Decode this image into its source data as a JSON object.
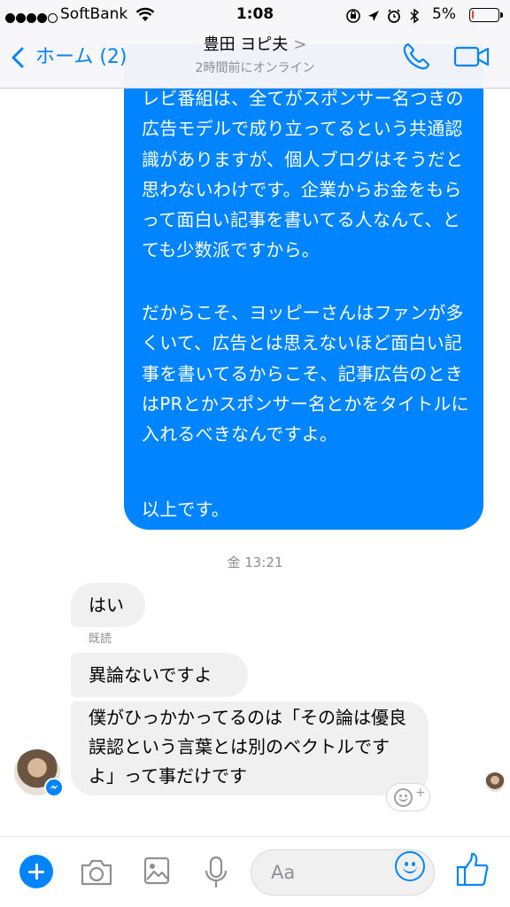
{
  "status_bar": {
    "carrier": "SoftBank",
    "time": "1:08",
    "battery_percent": "5%",
    "battery_level": 0.05,
    "icons": [
      "signal-dots-icon",
      "wifi-icon",
      "orientation-lock-icon",
      "location-icon",
      "alarm-icon",
      "bluetooth-icon",
      "battery-icon"
    ]
  },
  "header": {
    "back_label": "ホーム (2)",
    "contact_name": "豊田 ヨピ夫",
    "name_chevron": ">",
    "presence": "2時間前にオンライン",
    "icons": [
      "chevron-left-icon",
      "phone-icon",
      "video-camera-icon"
    ]
  },
  "messages": {
    "outgoing_paragraphs": [
      "レビ番組は、全てがスポンサー名つきの広告モデルで成り立ってるという共通認識がありますが、個人ブログはそうだと思わないわけです。企業からお金をもらって面白い記事を書いてる人なんて、とても少数派ですから。",
      "だからこそ、ヨッピーさんはファンが多くいて、広告とは思えないほど面白い記事を書いてるからこそ、記事広告のときはPRとかスポンサー名とかをタイトルに入れるべきなんですよ。",
      "以上です。"
    ],
    "timestamp": "金 13:21",
    "incoming": [
      "はい",
      "異論ないですよ",
      "僕がひっかかってるのは「その論は優良誤認という言葉とは別のベクトルですよ」って事だけです"
    ],
    "read_receipt": "既読",
    "react_plus": "+"
  },
  "composer": {
    "placeholder": "Aa",
    "icons": [
      "plus-icon",
      "camera-icon",
      "photo-icon",
      "microphone-icon",
      "emoji-icon",
      "thumbs-up-icon"
    ]
  },
  "colors": {
    "accent": "#0084ff",
    "incoming_bubble": "#f1f0f0",
    "secondary_text": "#8e8e93",
    "battery_low": "#ff3b30"
  }
}
